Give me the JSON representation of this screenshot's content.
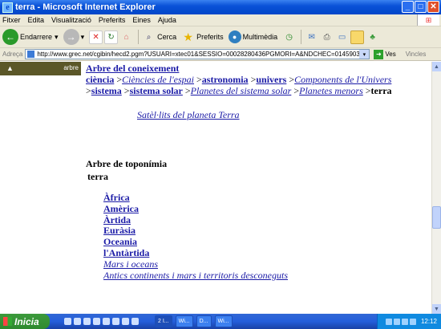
{
  "window": {
    "title": "terra - Microsoft Internet Explorer"
  },
  "menu": [
    "Fitxer",
    "Edita",
    "Visualització",
    "Preferits",
    "Eines",
    "Ajuda"
  ],
  "toolbar": {
    "back_label": "Endarrere",
    "search_label": "Cerca",
    "favorites_label": "Preferits",
    "media_label": "Multimèdia"
  },
  "address": {
    "label": "Adreça",
    "url": "http://www.grec.net/cgibin/hecd2.pgm?USUARI=xtec01&SESSIO=00028280436PGMORI=A&NDCHEC=0145903#ar",
    "go_label": "Ves",
    "links_label": "Vincles"
  },
  "sidebar": {
    "label": "arbre"
  },
  "breadcrumb": {
    "heading": "Arbre del coneixement",
    "items": [
      {
        "text": "ciència",
        "style": "b"
      },
      {
        "text": "Ciències de l'espai",
        "style": "i"
      },
      {
        "text": "astronomia",
        "style": "b"
      },
      {
        "text": "univers",
        "style": "b"
      },
      {
        "text": "Components de l'Univers",
        "style": "i"
      },
      {
        "text": "sistema",
        "style": "b"
      },
      {
        "text": "sistema solar",
        "style": "b"
      },
      {
        "text": "Planetes del sistema solar",
        "style": "i"
      },
      {
        "text": "Planetes menors",
        "style": "i"
      }
    ],
    "current": "terra"
  },
  "satellites_link": "Satèl·lits del planeta Terra",
  "toponymy": {
    "title": "Arbre de toponímia",
    "subtitle": "terra",
    "items": [
      {
        "text": "Àfrica",
        "style": "b"
      },
      {
        "text": "Amèrica",
        "style": "b"
      },
      {
        "text": "Àrtida",
        "style": "b"
      },
      {
        "text": "Euràsia",
        "style": "b"
      },
      {
        "text": "Oceania",
        "style": "b"
      },
      {
        "text": "l'Antàrtida",
        "style": "b"
      },
      {
        "text": "Mars i oceans",
        "style": "i"
      },
      {
        "text": "Antics continents i mars i territoris desconeguts",
        "style": "i"
      }
    ]
  },
  "taskbar": {
    "start_label": "Inicia",
    "tasks": [
      "2 I...",
      "Wi...",
      "D...",
      "Wi..."
    ],
    "clock": "12:12"
  }
}
